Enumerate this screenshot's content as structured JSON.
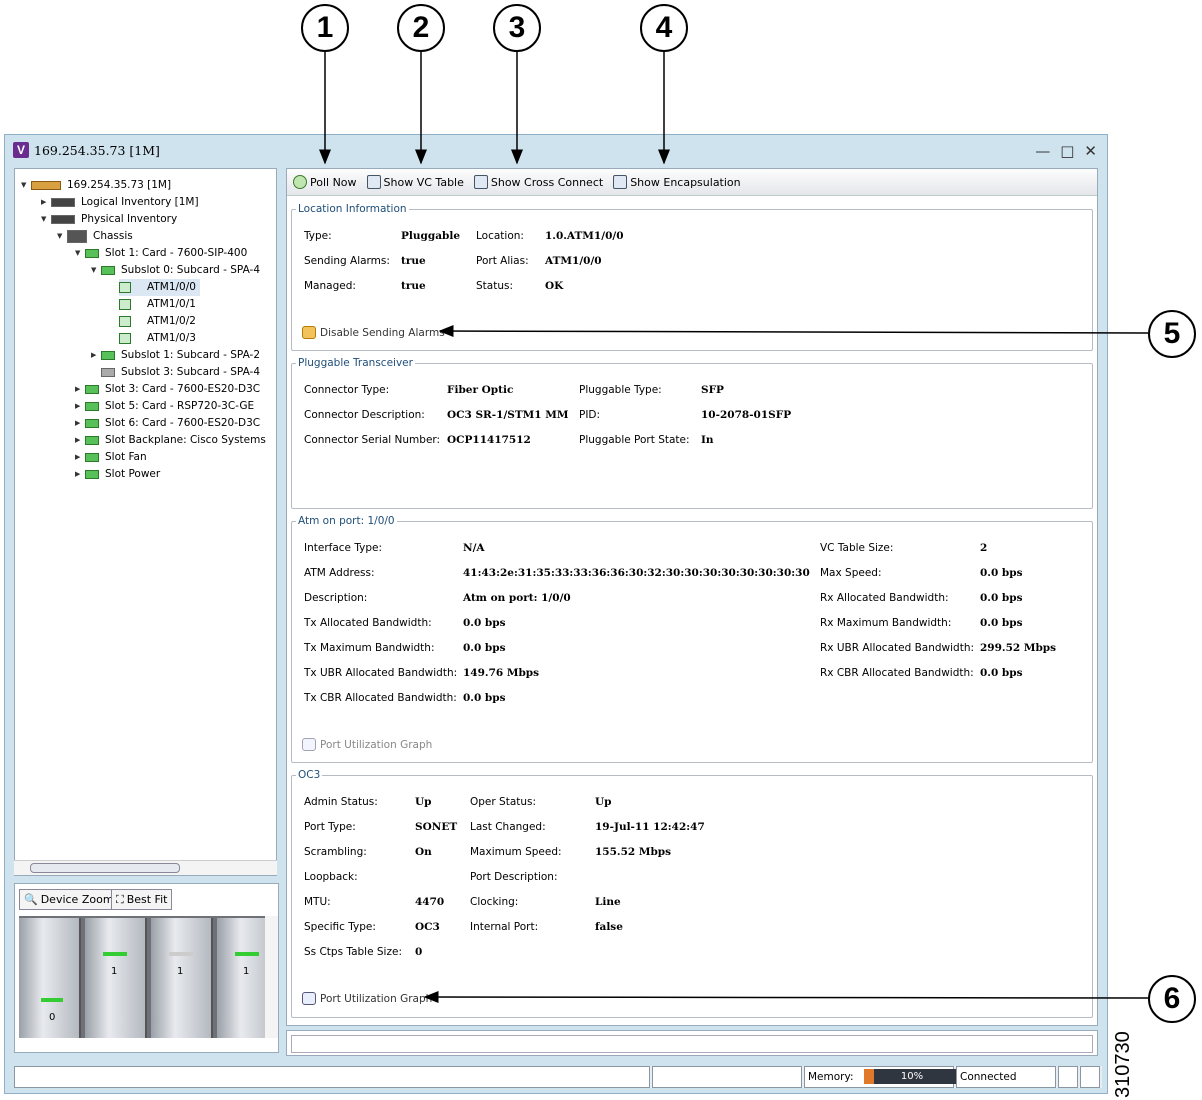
{
  "callouts": [
    "1",
    "2",
    "3",
    "4",
    "5",
    "6"
  ],
  "figure_number": "310730",
  "window": {
    "title": "169.254.35.73 [1M]",
    "logo": "V"
  },
  "tree": {
    "root": "169.254.35.73 [1M]",
    "logical": "Logical Inventory [1M]",
    "physical": "Physical Inventory",
    "chassis": "Chassis",
    "slot1": "Slot 1: Card - 7600-SIP-400",
    "subslot0": "Subslot 0: Subcard - SPA-4",
    "ports": [
      "ATM1/0/0",
      "ATM1/0/1",
      "ATM1/0/2",
      "ATM1/0/3"
    ],
    "subslot1": "Subslot 1: Subcard - SPA-2",
    "subslot3": "Subslot 3: Subcard - SPA-4",
    "slot3": "Slot 3: Card - 7600-ES20-D3C",
    "slot5": "Slot 5: Card - RSP720-3C-GE",
    "slot6": "Slot 6: Card - 7600-ES20-D3C",
    "backplane": "Slot Backplane: Cisco Systems",
    "fan": "Slot Fan",
    "power": "Slot Power"
  },
  "navigator": {
    "zoom_label": "Device Zoom",
    "fit_label": "Best Fit",
    "card_labels": [
      "0",
      "1",
      "1",
      "1"
    ]
  },
  "toolbar": {
    "poll": "Poll Now",
    "vc": "Show VC Table",
    "cross": "Show Cross Connect",
    "encap": "Show Encapsulation"
  },
  "location": {
    "title": "Location Information",
    "type_l": "Type:",
    "type_v": "Pluggable",
    "loc_l": "Location:",
    "loc_v": "1.0.ATM1/0/0",
    "send_l": "Sending Alarms:",
    "send_v": "true",
    "alias_l": "Port Alias:",
    "alias_v": "ATM1/0/0",
    "man_l": "Managed:",
    "man_v": "true",
    "stat_l": "Status:",
    "stat_v": "OK",
    "action": "Disable Sending Alarms"
  },
  "pluggable": {
    "title": "Pluggable Transceiver",
    "ct_l": "Connector Type:",
    "ct_v": "Fiber Optic",
    "pt_l": "Pluggable Type:",
    "pt_v": "SFP",
    "cd_l": "Connector Description:",
    "cd_v": "OC3 SR-1/STM1 MM",
    "pid_l": "PID:",
    "pid_v": "10-2078-01SFP",
    "csn_l": "Connector Serial Number:",
    "csn_v": "OCP11417512",
    "pps_l": "Pluggable Port State:",
    "pps_v": "In"
  },
  "atm": {
    "title": "Atm on port: 1/0/0",
    "left": [
      {
        "l": "Interface Type:",
        "v": "N/A"
      },
      {
        "l": "ATM Address:",
        "v": "41:43:2e:31:35:33:33:36:36:30:32:30:30:30:30:30:30:30:30"
      },
      {
        "l": "Description:",
        "v": "Atm on port: 1/0/0"
      },
      {
        "l": "Tx Allocated Bandwidth:",
        "v": "0.0 bps"
      },
      {
        "l": "Tx Maximum Bandwidth:",
        "v": "0.0 bps"
      },
      {
        "l": "Tx UBR Allocated Bandwidth:",
        "v": "149.76 Mbps"
      },
      {
        "l": "Tx CBR Allocated Bandwidth:",
        "v": "0.0 bps"
      }
    ],
    "right": [
      {
        "l": "VC Table Size:",
        "v": "2"
      },
      {
        "l": "Max Speed:",
        "v": "0.0 bps"
      },
      {
        "l": "Rx Allocated Bandwidth:",
        "v": "0.0 bps"
      },
      {
        "l": "Rx Maximum Bandwidth:",
        "v": "0.0 bps"
      },
      {
        "l": "Rx UBR Allocated Bandwidth:",
        "v": "299.52 Mbps"
      },
      {
        "l": "Rx CBR Allocated Bandwidth:",
        "v": "0.0 bps"
      }
    ],
    "action": "Port Utilization Graph"
  },
  "oc3": {
    "title": "OC3",
    "left": [
      {
        "l": "Admin Status:",
        "v": "Up"
      },
      {
        "l": "Port Type:",
        "v": "SONET"
      },
      {
        "l": "Scrambling:",
        "v": "On"
      },
      {
        "l": "Loopback:",
        "v": ""
      },
      {
        "l": "MTU:",
        "v": "4470"
      },
      {
        "l": "Specific Type:",
        "v": "OC3"
      },
      {
        "l": "Ss Ctps Table Size:",
        "v": "0"
      }
    ],
    "right": [
      {
        "l": "Oper Status:",
        "v": "Up"
      },
      {
        "l": "Last Changed:",
        "v": "19-Jul-11 12:42:47"
      },
      {
        "l": "Maximum Speed:",
        "v": "155.52 Mbps"
      },
      {
        "l": "Port Description:",
        "v": ""
      },
      {
        "l": "Clocking:",
        "v": "Line"
      },
      {
        "l": "Internal Port:",
        "v": "false"
      }
    ],
    "action": "Port Utilization Graph"
  },
  "status": {
    "memory_label": "Memory:",
    "memory_pct": "10%",
    "memory_fraction": 0.1,
    "connection": "Connected"
  }
}
